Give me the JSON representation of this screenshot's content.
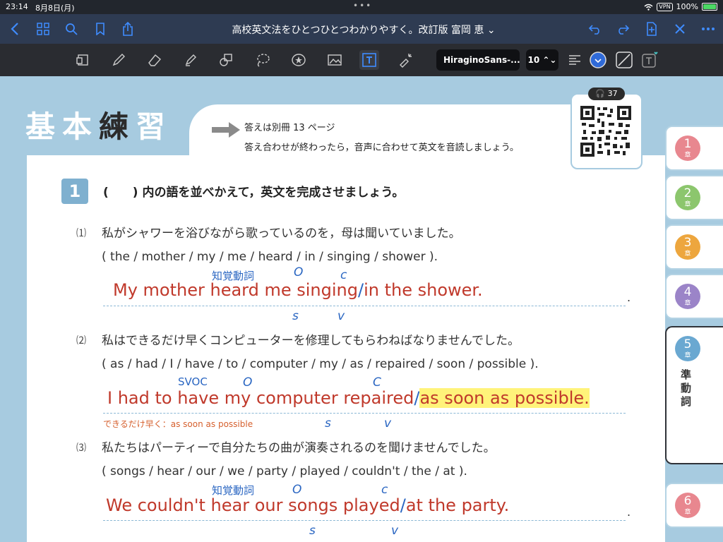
{
  "status": {
    "time": "23:14",
    "date": "8月8日(月)",
    "vpn": "VPN",
    "battery": "100%"
  },
  "nav": {
    "title": "高校英文法をひとつひとつわかりやすく。改訂版 富岡 恵 ⌄"
  },
  "toolbar": {
    "font": "HiraginoSans-...",
    "size": "10 ⌃⌄",
    "accent": "#2f6ad8"
  },
  "page": {
    "heading_light1": "基",
    "heading_light2": "本",
    "heading_dark": "練",
    "heading_light3": "習",
    "answer_line1": "答えは別冊 13 ページ",
    "answer_line2": "答え合わせが終わったら，音声に合わせて英文を音読しましょう。",
    "audio_badge": "37",
    "q_number": "1",
    "q_instruction": "(　　) 内の語を並べかえて，英文を完成させましょう。",
    "items": [
      {
        "label": "⑴",
        "japanese": "私がシャワーを浴びながら歌っているのを，母は聞いていました。",
        "words": "( the / mother / my / me / heard / in / singing / shower ).",
        "answer": "My mother heard me singing",
        "answer_rest": "in the shower.",
        "note_blue": "知覚動詞",
        "mark_o": "O",
        "mark_c": "c",
        "mark_s": "s",
        "mark_v": "v"
      },
      {
        "label": "⑵",
        "japanese": "私はできるだけ早くコンピューターを修理してもらわねばなりませんでした。",
        "words": "( as / had / I / have / to / computer / my / as / repaired / soon / possible ).",
        "answer": "I had to have my computer repaired",
        "answer_rest": "as soon as possible.",
        "note_blue": "SVOC",
        "note_orange": "できるだけ早く：as soon as possible",
        "mark_o": "O",
        "mark_c": "C",
        "mark_s": "s",
        "mark_v": "v"
      },
      {
        "label": "⑶",
        "japanese": "私たちはパーティーで自分たちの曲が演奏されるのを聞けませんでした。",
        "words": "( songs / hear / our / we / party / played / couldn't / the / at ).",
        "answer": "We couldn't hear our songs played",
        "answer_rest": "at the party.",
        "note_blue": "知覚動詞",
        "mark_o": "O",
        "mark_c": "c",
        "mark_s": "s",
        "mark_v": "v"
      }
    ]
  },
  "tabs": [
    {
      "num": "1",
      "chapter": "章",
      "color": "#e8878f"
    },
    {
      "num": "2",
      "chapter": "章",
      "color": "#8cc66d"
    },
    {
      "num": "3",
      "chapter": "章",
      "color": "#eda63e"
    },
    {
      "num": "4",
      "chapter": "章",
      "color": "#9b84c8"
    },
    {
      "num": "5",
      "chapter": "章",
      "color": "#6aa8d1",
      "label": "準動詞"
    },
    {
      "num": "6",
      "chapter": "章",
      "color": "#e8878f"
    }
  ]
}
